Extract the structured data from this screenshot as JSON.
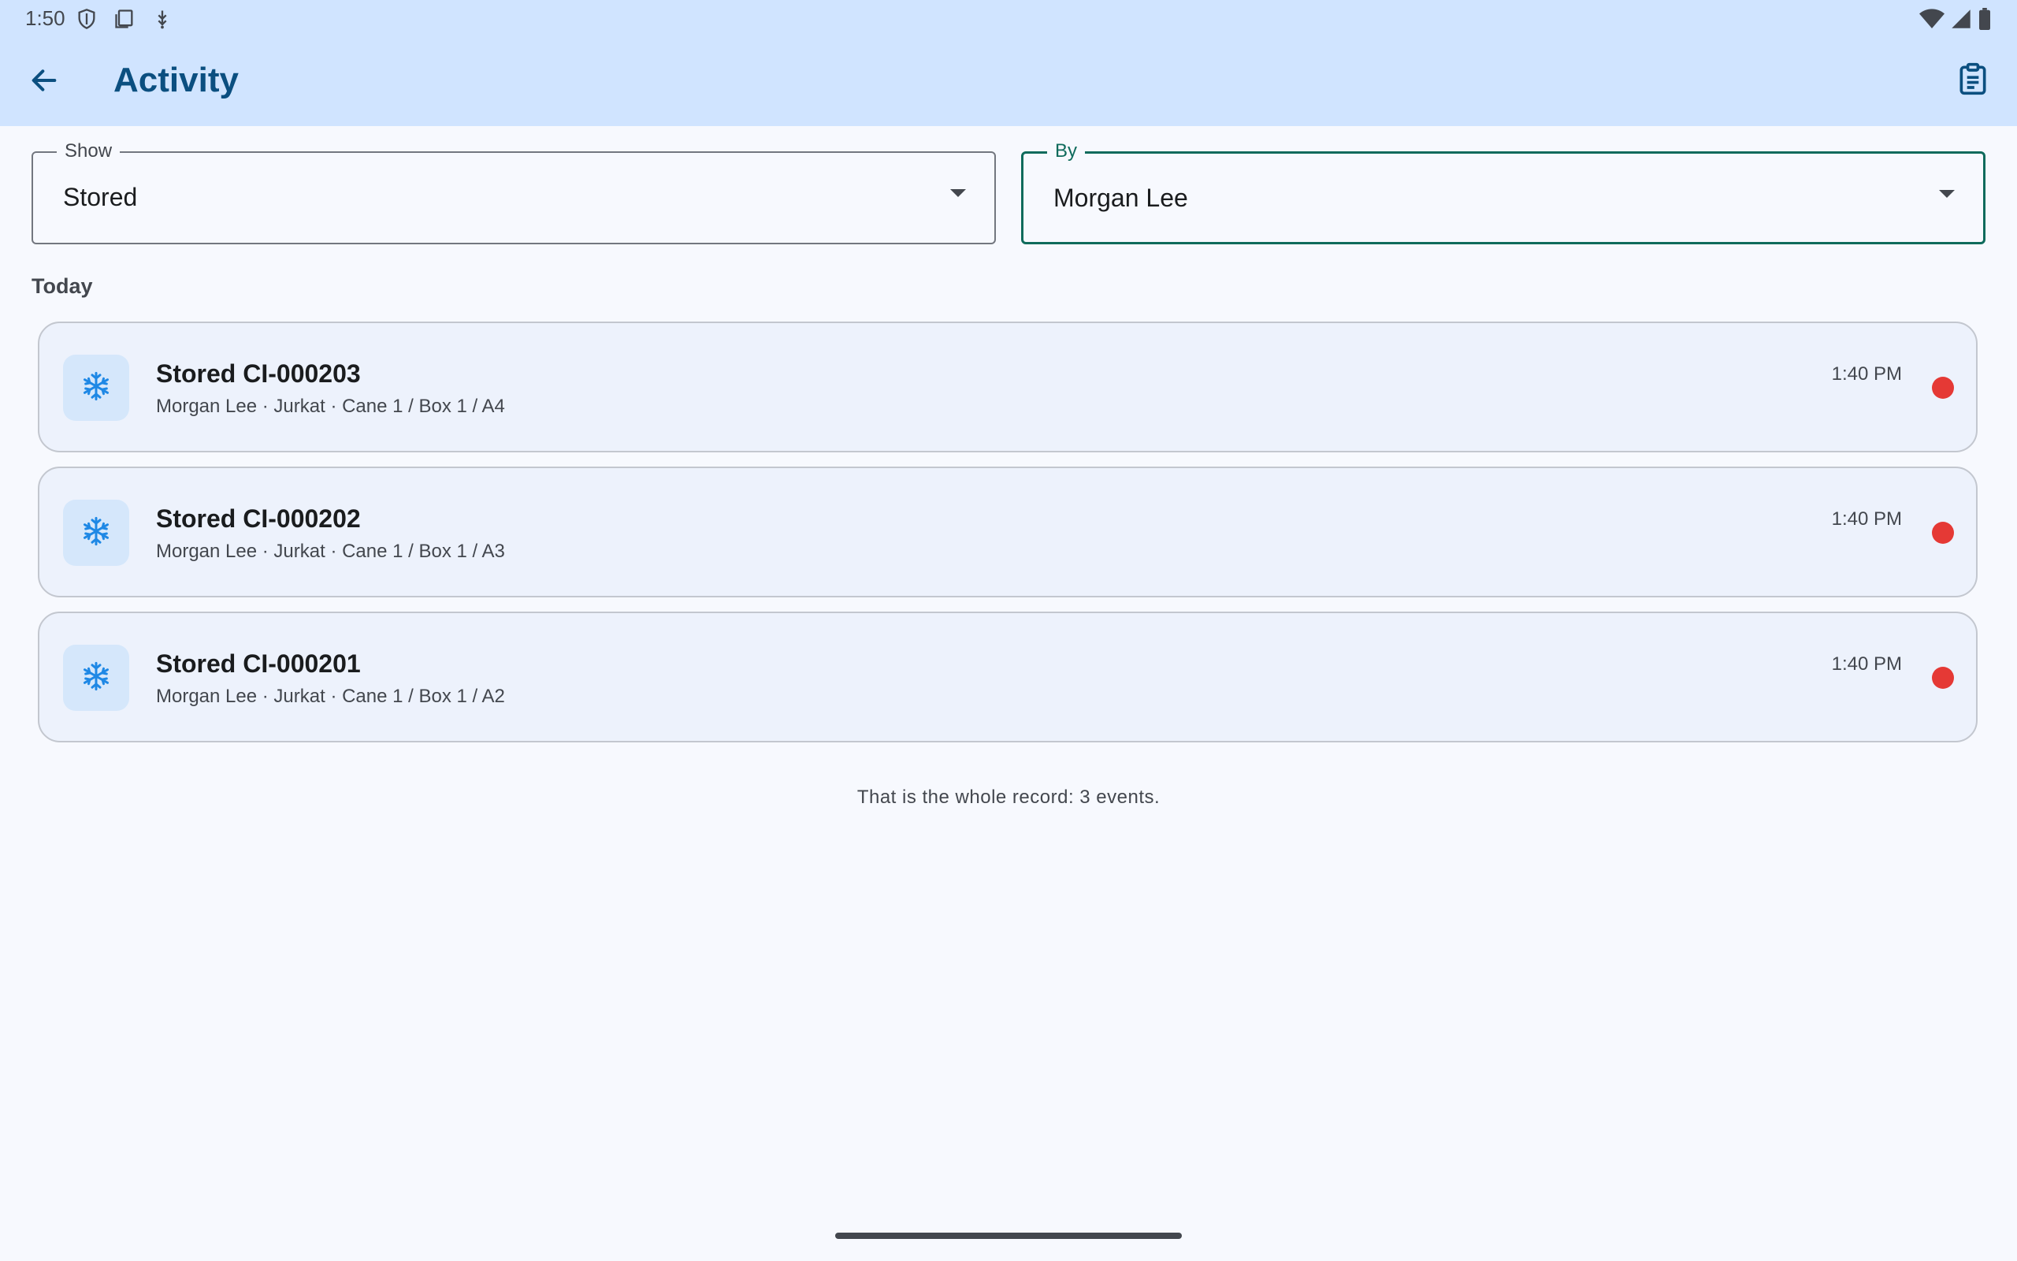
{
  "status_bar": {
    "time": "1:50",
    "left_icons": [
      "shield-icon",
      "screenshot-icon",
      "usb-debug-icon"
    ],
    "right_icons": [
      "wifi-icon",
      "cell-signal-icon",
      "battery-icon"
    ]
  },
  "app_bar": {
    "title": "Activity",
    "back_icon": "arrow-back-icon",
    "action_icon": "clipboard-list-icon"
  },
  "filters": {
    "show": {
      "label": "Show",
      "value": "Stored"
    },
    "by": {
      "label": "By",
      "value": "Morgan Lee"
    }
  },
  "section": {
    "header": "Today"
  },
  "events": [
    {
      "title": "Stored CI-000203",
      "subtitle": "Morgan Lee · Jurkat · Cane 1 / Box 1 / A4",
      "time": "1:40 PM",
      "icon": "snowflake-icon",
      "status_color": "#e53935"
    },
    {
      "title": "Stored CI-000202",
      "subtitle": "Morgan Lee · Jurkat · Cane 1 / Box 1 / A3",
      "time": "1:40 PM",
      "icon": "snowflake-icon",
      "status_color": "#e53935"
    },
    {
      "title": "Stored CI-000201",
      "subtitle": "Morgan Lee · Jurkat · Cane 1 / Box 1 / A2",
      "time": "1:40 PM",
      "icon": "snowflake-icon",
      "status_color": "#e53935"
    }
  ],
  "footer": {
    "note": "That is the whole record: 3 events."
  },
  "colors": {
    "app_bar_bg": "#d0e4ff",
    "title": "#0b4f80",
    "focused_field": "#0f6b5c",
    "card_bg": "#edf2fc",
    "icon_tile_bg": "#d5e7fb",
    "snowflake": "#1e88e5",
    "status_dot": "#e53935"
  }
}
